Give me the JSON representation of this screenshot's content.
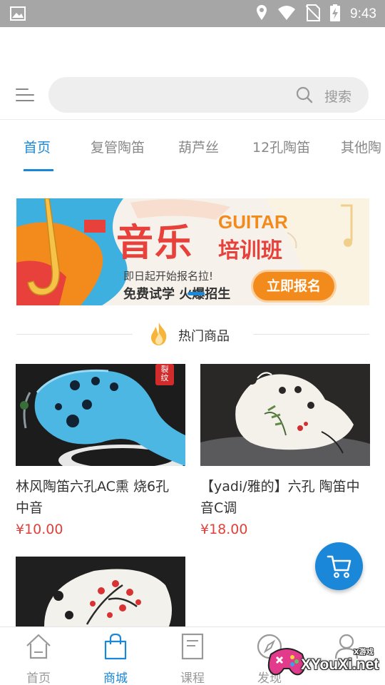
{
  "status_bar": {
    "time": "9:43",
    "icons": [
      "image-icon",
      "location-icon",
      "wifi-icon",
      "no-sim-icon",
      "battery-charging-icon"
    ]
  },
  "header": {
    "menu_icon": "menu-icon",
    "search": {
      "placeholder": "搜索",
      "icon": "search-icon"
    }
  },
  "tabs": [
    {
      "label": "首页",
      "active": true
    },
    {
      "label": "复管陶笛",
      "active": false
    },
    {
      "label": "葫芦丝",
      "active": false
    },
    {
      "label": "12孔陶笛",
      "active": false
    },
    {
      "label": "其他陶",
      "active": false
    }
  ],
  "banner": {
    "title_cn": "音乐",
    "title_en": "GUITAR",
    "subtitle": "培训班",
    "line1": "即日起开始报名拉!",
    "line2": "免费试学 火爆招生",
    "cta": "立即报名",
    "colors": {
      "red": "#e8403a",
      "orange": "#f28a1c",
      "yellow": "#f6c248",
      "blue": "#3db0e0"
    }
  },
  "hot_section": {
    "title": "热门商品",
    "icon": "fire-icon"
  },
  "products": [
    {
      "name": "林风陶笛六孔AC熏 烧6孔中音",
      "price": "¥10.00",
      "badge": "裂纹"
    },
    {
      "name": "【yadi/雅的】六孔 陶笛中音C调",
      "price": "¥18.00"
    },
    {
      "name": "",
      "price": ""
    }
  ],
  "cart_button": {
    "icon": "cart-icon",
    "color": "#1a87d8"
  },
  "bottom_nav": [
    {
      "label": "首页",
      "icon": "home-icon",
      "active": false
    },
    {
      "label": "商城",
      "icon": "shopping-bag-icon",
      "active": true
    },
    {
      "label": "课程",
      "icon": "document-icon",
      "active": false
    },
    {
      "label": "发现",
      "icon": "compass-icon",
      "active": false
    },
    {
      "label": "",
      "icon": "profile-icon",
      "active": false
    }
  ],
  "watermark": {
    "small": "X游戏",
    "text": "XYouXi.net"
  },
  "colors": {
    "accent": "#1a87d8",
    "price": "#e0413a",
    "status_bar": "#a6a6a6"
  }
}
